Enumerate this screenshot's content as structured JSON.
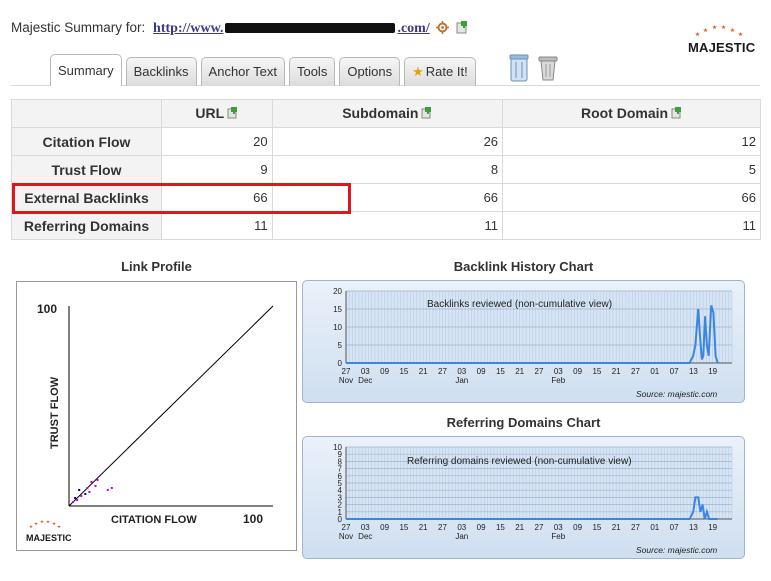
{
  "header": {
    "prefix": "Majestic Summary for:",
    "url_start": "http://www.",
    "url_end": ".com/"
  },
  "logo": {
    "text": "MAJESTIC"
  },
  "tabs": [
    {
      "label": "Summary",
      "active": true
    },
    {
      "label": "Backlinks",
      "active": false
    },
    {
      "label": "Anchor Text",
      "active": false
    },
    {
      "label": "Tools",
      "active": false
    },
    {
      "label": "Options",
      "active": false
    },
    {
      "label": "Rate It!",
      "active": false
    }
  ],
  "summary_table": {
    "columns": [
      "URL",
      "Subdomain",
      "Root Domain"
    ],
    "rows": [
      {
        "label": "Citation Flow",
        "values": [
          "20",
          "26",
          "12"
        ]
      },
      {
        "label": "Trust Flow",
        "values": [
          "9",
          "8",
          "5"
        ]
      },
      {
        "label": "External Backlinks",
        "values": [
          "66",
          "66",
          "66"
        ]
      },
      {
        "label": "Referring Domains",
        "values": [
          "11",
          "11",
          "11"
        ]
      }
    ]
  },
  "link_profile": {
    "title": "Link Profile",
    "y_label": "TRUST FLOW",
    "x_label": "CITATION FLOW",
    "y_max_label": "100",
    "x_max_label": "100",
    "logo_text": "MAJESTIC"
  },
  "backlink_history": {
    "title": "Backlink History Chart",
    "caption": "Backlinks reviewed (non-cumulative view)",
    "source": "Source: majestic.com"
  },
  "referring_domains": {
    "title": "Referring Domains Chart",
    "caption": "Referring domains reviewed (non-cumulative view)",
    "source": "Source: majestic.com"
  },
  "colors": {
    "highlight": "#e0151e",
    "series_line": "#3a86e0",
    "chart_fill": "#d6e4f4",
    "link_profile_dot_magenta": "#cc00cc",
    "link_profile_dot_navy": "#000080"
  },
  "chart_data": [
    {
      "type": "scatter",
      "title": "Link Profile",
      "xlabel": "CITATION FLOW",
      "ylabel": "TRUST FLOW",
      "xlim": [
        0,
        100
      ],
      "ylim": [
        0,
        100
      ],
      "reference_line": "y = x",
      "points": [
        {
          "x": 2,
          "y": 2,
          "color": "#cc00cc"
        },
        {
          "x": 3,
          "y": 4,
          "color": "#000080"
        },
        {
          "x": 4,
          "y": 3,
          "color": "#cc00cc"
        },
        {
          "x": 5,
          "y": 8,
          "color": "#000080"
        },
        {
          "x": 6,
          "y": 5,
          "color": "#cc00cc"
        },
        {
          "x": 8,
          "y": 6,
          "color": "#000080"
        },
        {
          "x": 9,
          "y": 9,
          "color": "#cc00cc"
        },
        {
          "x": 10,
          "y": 7,
          "color": "#cc00cc"
        },
        {
          "x": 11,
          "y": 12,
          "color": "#cc00cc"
        },
        {
          "x": 13,
          "y": 10,
          "color": "#cc00cc"
        },
        {
          "x": 14,
          "y": 13,
          "color": "#cc00cc"
        },
        {
          "x": 19,
          "y": 8,
          "color": "#cc00cc"
        },
        {
          "x": 21,
          "y": 9,
          "color": "#cc00cc"
        }
      ]
    },
    {
      "type": "area",
      "title": "Backlinks reviewed (non-cumulative view)",
      "ylim": [
        0,
        20
      ],
      "yticks": [
        0,
        5,
        10,
        15,
        20
      ],
      "x_tick_labels": [
        "27",
        "03",
        "09",
        "15",
        "21",
        "27",
        "03",
        "09",
        "15",
        "21",
        "27",
        "03",
        "09",
        "15",
        "21",
        "27",
        "01",
        "07",
        "13",
        "19"
      ],
      "x_month_labels": [
        "Nov",
        "Dec",
        "Jan",
        "Feb"
      ],
      "series": [
        {
          "points": [
            [
              0.0,
              0
            ],
            [
              0.952,
              0
            ],
            [
              0.962,
              2
            ],
            [
              0.968,
              5
            ],
            [
              0.976,
              15
            ],
            [
              0.982,
              6
            ],
            [
              0.986,
              1
            ],
            [
              0.99,
              2
            ],
            [
              0.995,
              13
            ],
            [
              1.0,
              5
            ],
            [
              1.005,
              2
            ],
            [
              1.012,
              16
            ],
            [
              1.018,
              14
            ],
            [
              1.024,
              2
            ],
            [
              1.03,
              0
            ]
          ]
        }
      ]
    },
    {
      "type": "area",
      "title": "Referring domains reviewed (non-cumulative view)",
      "ylim": [
        0,
        10
      ],
      "yticks": [
        0,
        1,
        2,
        3,
        4,
        5,
        6,
        7,
        8,
        9,
        10
      ],
      "x_tick_labels": [
        "27",
        "03",
        "09",
        "15",
        "21",
        "27",
        "03",
        "09",
        "15",
        "21",
        "27",
        "03",
        "09",
        "15",
        "21",
        "27",
        "01",
        "07",
        "13",
        "19"
      ],
      "x_month_labels": [
        "Nov",
        "Dec",
        "Jan",
        "Feb"
      ],
      "series": [
        {
          "points": [
            [
              0.0,
              0
            ],
            [
              0.952,
              0
            ],
            [
              0.962,
              1
            ],
            [
              0.968,
              3
            ],
            [
              0.976,
              3
            ],
            [
              0.982,
              1
            ],
            [
              0.988,
              2
            ],
            [
              0.994,
              0
            ],
            [
              1.0,
              1
            ],
            [
              1.006,
              0
            ],
            [
              1.03,
              0
            ]
          ]
        }
      ]
    }
  ]
}
